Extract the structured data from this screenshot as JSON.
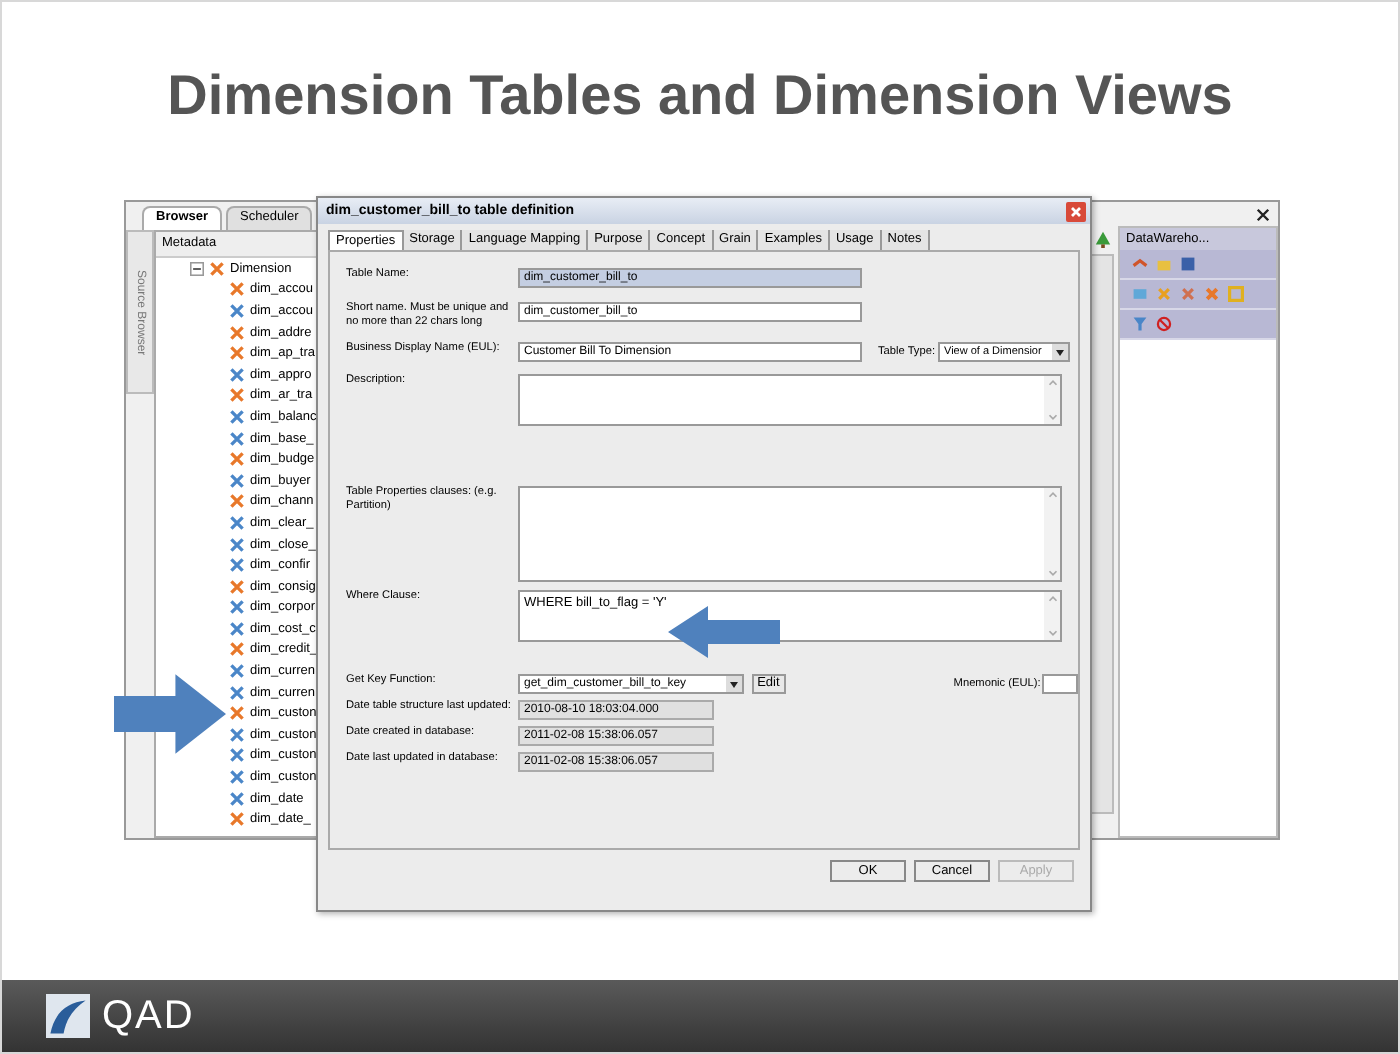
{
  "slide": {
    "title": "Dimension Tables and Dimension Views",
    "logo": "QAD"
  },
  "app_window": {
    "tabs": [
      {
        "label": "Browser",
        "selected": true
      },
      {
        "label": "Scheduler",
        "selected": false
      }
    ],
    "side_tab": "Source Browser",
    "tree": {
      "header": "Metadata",
      "root": {
        "label": "Dimension",
        "expanded": true,
        "children": [
          {
            "label": "dim_accou",
            "color": "#e8782a"
          },
          {
            "label": "dim_accou",
            "color": "#4a86c8"
          },
          {
            "label": "dim_addre",
            "color": "#e8782a"
          },
          {
            "label": "dim_ap_tra",
            "color": "#e8782a"
          },
          {
            "label": "dim_appro",
            "color": "#4a86c8"
          },
          {
            "label": "dim_ar_tra",
            "color": "#e8782a"
          },
          {
            "label": "dim_balanc",
            "color": "#4a86c8"
          },
          {
            "label": "dim_base_",
            "color": "#4a86c8"
          },
          {
            "label": "dim_budge",
            "color": "#e8782a"
          },
          {
            "label": "dim_buyer",
            "color": "#4a86c8"
          },
          {
            "label": "dim_chann",
            "color": "#e8782a"
          },
          {
            "label": "dim_clear_",
            "color": "#4a86c8"
          },
          {
            "label": "dim_close_",
            "color": "#4a86c8"
          },
          {
            "label": "dim_confir",
            "color": "#4a86c8"
          },
          {
            "label": "dim_consig",
            "color": "#e8782a"
          },
          {
            "label": "dim_corpor",
            "color": "#4a86c8"
          },
          {
            "label": "dim_cost_c",
            "color": "#4a86c8"
          },
          {
            "label": "dim_credit_",
            "color": "#e8782a"
          },
          {
            "label": "dim_curren",
            "color": "#4a86c8"
          },
          {
            "label": "dim_curren",
            "color": "#4a86c8"
          },
          {
            "label": "dim_custon",
            "color": "#e8782a"
          },
          {
            "label": "dim_custon",
            "color": "#4a86c8"
          },
          {
            "label": "dim_custon",
            "color": "#4a86c8"
          },
          {
            "label": "dim_custon",
            "color": "#4a86c8"
          },
          {
            "label": "dim_date",
            "color": "#4a86c8"
          },
          {
            "label": "dim_date_",
            "color": "#e8782a"
          }
        ]
      }
    },
    "panel": {
      "title": "DataWareho..."
    }
  },
  "dialog": {
    "title": "dim_customer_bill_to table definition",
    "tabs": [
      {
        "label": "Properties",
        "selected": true
      },
      {
        "label": "Storage",
        "selected": false
      },
      {
        "label": "Language Mapping",
        "selected": false
      },
      {
        "label": "Purpose",
        "selected": false
      },
      {
        "label": "Concept",
        "selected": false
      },
      {
        "label": "Grain",
        "selected": false
      },
      {
        "label": "Examples",
        "selected": false
      },
      {
        "label": "Usage",
        "selected": false
      },
      {
        "label": "Notes",
        "selected": false
      }
    ],
    "fields": [
      {
        "kind": "text",
        "label": "Table Name:",
        "value": "dim_customer_bill_to",
        "highlighted": true
      },
      {
        "kind": "text",
        "label": "Short name. Must be unique and no more than 22 chars long",
        "value": "dim_customer_bill_to",
        "highlighted": false
      },
      {
        "kind": "text",
        "label": "Business Display Name (EUL):",
        "value": "Customer Bill To Dimension",
        "highlighted": false,
        "extra": {
          "label": "Table Type:",
          "value": "View of a Dimensior"
        }
      },
      {
        "kind": "textarea",
        "label": "Description:"
      },
      {
        "kind": "textarea",
        "label": "Table Properties clauses: (e.g. Partition)"
      },
      {
        "kind": "textarea",
        "label": "Where Clause:",
        "value": "WHERE bill_to_flag = 'Y'"
      },
      {
        "kind": "combo",
        "label": "Get Key Function:",
        "value": "get_dim_customer_bill_to_key",
        "button": "Edit",
        "extra": {
          "label": "Mnemonic (EUL):"
        }
      },
      {
        "kind": "readonly",
        "label": "Date table structure last updated:",
        "value": "2010-08-10 18:03:04.000"
      },
      {
        "kind": "readonly",
        "label": "Date created in database:",
        "value": "2011-02-08 15:38:06.057"
      },
      {
        "kind": "readonly",
        "label": "Date last updated in database:",
        "value": "2011-02-08 15:38:06.057"
      }
    ],
    "buttons": [
      {
        "label": "OK",
        "disabled": false
      },
      {
        "label": "Cancel",
        "disabled": false
      },
      {
        "label": "Apply",
        "disabled": true
      }
    ]
  }
}
